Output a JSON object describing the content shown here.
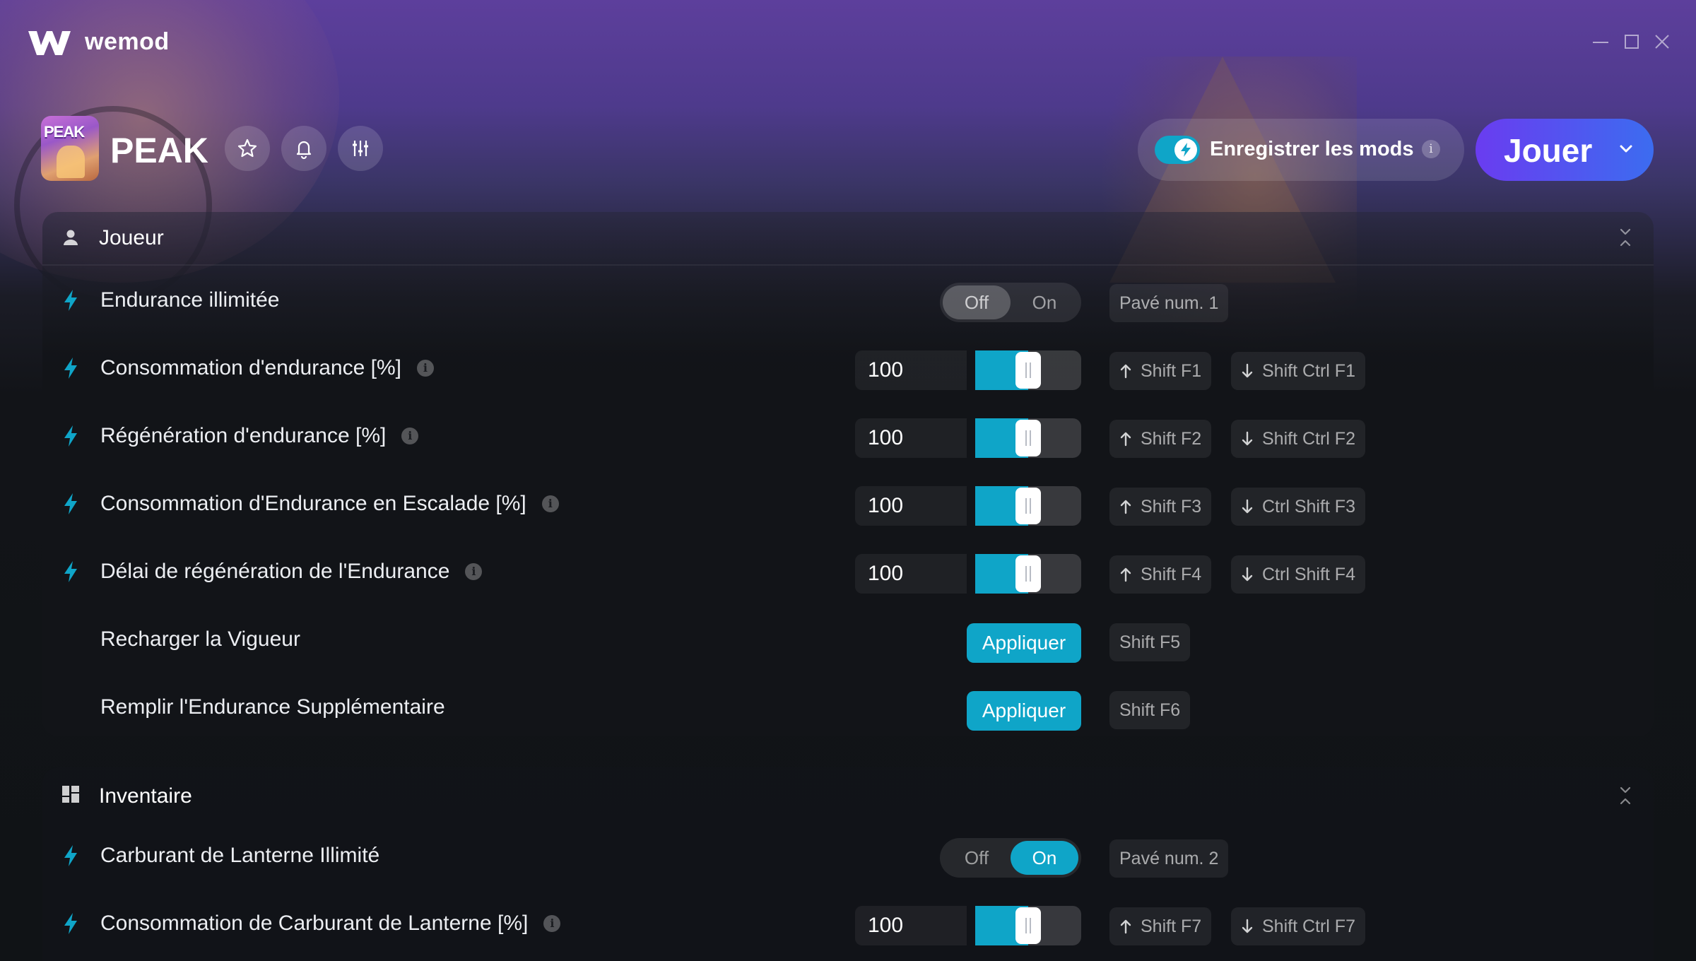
{
  "app": {
    "brand": "wemod",
    "game_title": "PEAK",
    "game_icon_text": "PEAK",
    "save_mods_label": "Enregistrer les mods",
    "save_mods_enabled": true,
    "play_label": "Jouer",
    "accent_color": "#0fa5c8",
    "play_gradient": [
      "#6a3cf0",
      "#3c6cf0"
    ]
  },
  "icons": {
    "favorite": "star-icon",
    "notifications": "bell-icon",
    "settings": "sliders-icon",
    "info": "info-icon",
    "mod": "lightning-bolt-icon"
  },
  "sections": [
    {
      "title": "Joueur",
      "icon": "user-icon",
      "rows": [
        {
          "label": "Endurance illimitée",
          "type": "toggle",
          "state": "Off",
          "off_label": "Off",
          "on_label": "On",
          "keys": [
            "Pavé num. 1"
          ]
        },
        {
          "label": "Consommation d'endurance [%]",
          "type": "slider",
          "value": "100",
          "fill": 0.5,
          "keys": [
            "Shift F1",
            "Shift Ctrl F1"
          ]
        },
        {
          "label": "Régénération d'endurance [%]",
          "type": "slider",
          "value": "100",
          "fill": 0.5,
          "keys": [
            "Shift F2",
            "Shift Ctrl F2"
          ]
        },
        {
          "label": "Consommation d'Endurance en Escalade [%]",
          "type": "slider",
          "value": "100",
          "fill": 0.5,
          "keys": [
            "Shift F3",
            "Ctrl Shift F3"
          ]
        },
        {
          "label": "Délai de régénération de l'Endurance",
          "type": "slider",
          "value": "100",
          "fill": 0.5,
          "keys": [
            "Shift F4",
            "Ctrl Shift F4"
          ]
        },
        {
          "label": "Recharger la Vigueur",
          "type": "button",
          "button_label": "Appliquer",
          "keys": [
            "Shift F5"
          ]
        },
        {
          "label": "Remplir l'Endurance Supplémentaire",
          "type": "button",
          "button_label": "Appliquer",
          "keys": [
            "Shift F6"
          ]
        }
      ]
    },
    {
      "title": "Inventaire",
      "icon": "grid-icon",
      "rows": [
        {
          "label": "Carburant de Lanterne Illimité",
          "type": "toggle",
          "state": "On",
          "off_label": "Off",
          "on_label": "On",
          "keys": [
            "Pavé num. 2"
          ]
        },
        {
          "label": "Consommation de Carburant de Lanterne [%]",
          "type": "slider",
          "value": "100",
          "fill": 0.5,
          "keys": [
            "Shift F7",
            "Shift Ctrl F7"
          ]
        }
      ]
    }
  ]
}
